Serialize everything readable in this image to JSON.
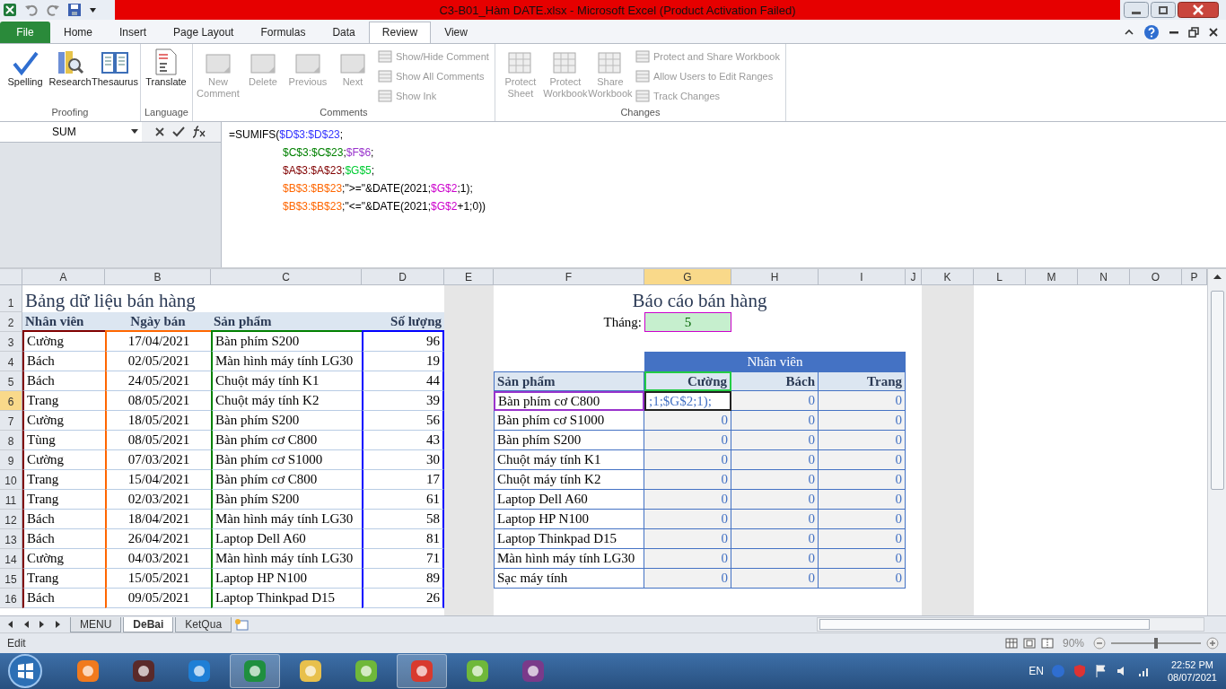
{
  "window": {
    "title": "C3-B01_Hàm DATE.xlsx  -  Microsoft Excel (Product Activation Failed)"
  },
  "ribbon_tabs": [
    {
      "label": "File",
      "kind": "file",
      "selected": false
    },
    {
      "label": "Home",
      "kind": "tab",
      "selected": false
    },
    {
      "label": "Insert",
      "kind": "tab",
      "selected": false
    },
    {
      "label": "Page Layout",
      "kind": "tab",
      "selected": false
    },
    {
      "label": "Formulas",
      "kind": "tab",
      "selected": false
    },
    {
      "label": "Data",
      "kind": "tab",
      "selected": false
    },
    {
      "label": "Review",
      "kind": "tab",
      "selected": true
    },
    {
      "label": "View",
      "kind": "tab",
      "selected": false
    }
  ],
  "ribbon_groups": [
    {
      "label": "Proofing",
      "buttons": [
        {
          "label": "Spelling",
          "kind": "large",
          "disabled": false
        },
        {
          "label": "Research",
          "kind": "large",
          "disabled": false
        },
        {
          "label": "Thesaurus",
          "kind": "large",
          "disabled": false
        }
      ]
    },
    {
      "label": "Language",
      "buttons": [
        {
          "label": "Translate",
          "kind": "large",
          "disabled": false
        }
      ]
    },
    {
      "label": "Comments",
      "buttons": [
        {
          "label": "New Comment",
          "kind": "large",
          "disabled": true
        },
        {
          "label": "Delete",
          "kind": "large",
          "disabled": true
        },
        {
          "label": "Previous",
          "kind": "large",
          "disabled": true
        },
        {
          "label": "Next",
          "kind": "large",
          "disabled": true
        },
        {
          "label": "Show/Hide Comment",
          "kind": "small",
          "disabled": true
        },
        {
          "label": "Show All Comments",
          "kind": "small",
          "disabled": true
        },
        {
          "label": "Show Ink",
          "kind": "small",
          "disabled": true
        }
      ]
    },
    {
      "label": "Changes",
      "buttons": [
        {
          "label": "Protect Sheet",
          "kind": "large",
          "disabled": true
        },
        {
          "label": "Protect Workbook",
          "kind": "large",
          "disabled": true
        },
        {
          "label": "Share Workbook",
          "kind": "large",
          "disabled": true
        },
        {
          "label": "Protect and Share Workbook",
          "kind": "small",
          "disabled": true
        },
        {
          "label": "Allow Users to Edit Ranges",
          "kind": "small",
          "disabled": true
        },
        {
          "label": "Track Changes",
          "kind": "small",
          "disabled": true
        }
      ]
    }
  ],
  "name_box": "SUM",
  "formula": [
    [
      {
        "text": "=SUMIFS("
      },
      {
        "text": "$D$3:$D$23",
        "color": "#3333ff"
      },
      {
        "text": ";"
      }
    ],
    [
      {
        "text": "$C$3:$C$23",
        "color": "#008000"
      },
      {
        "text": ";"
      },
      {
        "text": "$F$6",
        "color": "#9933cc"
      },
      {
        "text": ";"
      }
    ],
    [
      {
        "text": "$A$3:$A$23",
        "color": "#800000"
      },
      {
        "text": ";"
      },
      {
        "text": "$G$5",
        "color": "#00cc33"
      },
      {
        "text": ";"
      }
    ],
    [
      {
        "text": "$B$3:$B$23",
        "color": "#ff6600"
      },
      {
        "text": ";\">=\"&DATE(2021;"
      },
      {
        "text": "$G$2",
        "color": "#cc00cc"
      },
      {
        "text": ";1);"
      }
    ],
    [
      {
        "text": "$B$3:$B$23",
        "color": "#ff6600"
      },
      {
        "text": ";\"<=\"&DATE(2021;"
      },
      {
        "text": "$G$2",
        "color": "#cc00cc"
      },
      {
        "text": "+1;0))"
      }
    ]
  ],
  "columns": [
    {
      "label": "A",
      "selected": false
    },
    {
      "label": "B",
      "selected": false
    },
    {
      "label": "C",
      "selected": false
    },
    {
      "label": "D",
      "selected": false
    },
    {
      "label": "E",
      "selected": false
    },
    {
      "label": "F",
      "selected": false
    },
    {
      "label": "G",
      "selected": true
    },
    {
      "label": "H",
      "selected": false
    },
    {
      "label": "I",
      "selected": false
    },
    {
      "label": "J",
      "selected": false
    },
    {
      "label": "K",
      "selected": false
    },
    {
      "label": "L",
      "selected": false
    },
    {
      "label": "M",
      "selected": false
    },
    {
      "label": "N",
      "selected": false
    },
    {
      "label": "O",
      "selected": false
    },
    {
      "label": "P",
      "selected": false
    }
  ],
  "rows": [
    {
      "label": "1",
      "selected": false
    },
    {
      "label": "2",
      "selected": false
    },
    {
      "label": "3",
      "selected": false
    },
    {
      "label": "4",
      "selected": false
    },
    {
      "label": "5",
      "selected": false
    },
    {
      "label": "6",
      "selected": true
    },
    {
      "label": "7",
      "selected": false
    },
    {
      "label": "8",
      "selected": false
    },
    {
      "label": "9",
      "selected": false
    },
    {
      "label": "10",
      "selected": false
    },
    {
      "label": "11",
      "selected": false
    },
    {
      "label": "12",
      "selected": false
    },
    {
      "label": "13",
      "selected": false
    },
    {
      "label": "14",
      "selected": false
    },
    {
      "label": "15",
      "selected": false
    },
    {
      "label": "16",
      "selected": false
    }
  ],
  "data_table": {
    "title": "Bảng dữ liệu bán hàng",
    "columns": [
      {
        "label": "Nhân viên",
        "color": "#800000"
      },
      {
        "label": "Ngày bán",
        "color": "#ff6600"
      },
      {
        "label": "Sản phẩm",
        "color": "#008000"
      },
      {
        "label": "Số lượng",
        "color": "#0000ff"
      }
    ],
    "rows": [
      [
        "Cường",
        "17/04/2021",
        "Bàn phím S200",
        "96"
      ],
      [
        "Bách",
        "02/05/2021",
        "Màn hình máy tính LG30",
        "19"
      ],
      [
        "Bách",
        "24/05/2021",
        "Chuột máy tính K1",
        "44"
      ],
      [
        "Trang",
        "08/05/2021",
        "Chuột máy tính K2",
        "39"
      ],
      [
        "Cường",
        "18/05/2021",
        "Bàn phím S200",
        "56"
      ],
      [
        "Tùng",
        "08/05/2021",
        "Bàn phím cơ C800",
        "43"
      ],
      [
        "Cường",
        "07/03/2021",
        "Bàn phím cơ S1000",
        "30"
      ],
      [
        "Trang",
        "15/04/2021",
        "Bàn phím cơ C800",
        "17"
      ],
      [
        "Trang",
        "02/03/2021",
        "Bàn phím S200",
        "61"
      ],
      [
        "Bách",
        "18/04/2021",
        "Màn hình máy tính LG30",
        "58"
      ],
      [
        "Bách",
        "26/04/2021",
        "Laptop Dell A60",
        "81"
      ],
      [
        "Cường",
        "04/03/2021",
        "Màn hình máy tính LG30",
        "71"
      ],
      [
        "Trang",
        "15/05/2021",
        "Laptop HP N100",
        "89"
      ],
      [
        "Bách",
        "09/05/2021",
        "Laptop Thinkpad D15",
        "26"
      ]
    ]
  },
  "report": {
    "title": "Báo cáo bán hàng",
    "month_label": "Tháng:",
    "month_value": "5",
    "group_header": "Nhân viên",
    "columns": [
      "Sản phẩm",
      "Cường",
      "Bách",
      "Trang"
    ],
    "rows": [
      {
        "product": "Bàn phím cơ C800",
        "values": [
          {
            "text": ";1;$G$2;1);",
            "editing": true
          },
          {
            "text": "0",
            "editing": false
          },
          {
            "text": "0",
            "editing": false
          }
        ]
      },
      {
        "product": "Bàn phím cơ S1000",
        "values": [
          {
            "text": "0",
            "editing": false
          },
          {
            "text": "0",
            "editing": false
          },
          {
            "text": "0",
            "editing": false
          }
        ]
      },
      {
        "product": "Bàn phím S200",
        "values": [
          {
            "text": "0",
            "editing": false
          },
          {
            "text": "0",
            "editing": false
          },
          {
            "text": "0",
            "editing": false
          }
        ]
      },
      {
        "product": "Chuột máy tính K1",
        "values": [
          {
            "text": "0",
            "editing": false
          },
          {
            "text": "0",
            "editing": false
          },
          {
            "text": "0",
            "editing": false
          }
        ]
      },
      {
        "product": "Chuột máy tính K2",
        "values": [
          {
            "text": "0",
            "editing": false
          },
          {
            "text": "0",
            "editing": false
          },
          {
            "text": "0",
            "editing": false
          }
        ]
      },
      {
        "product": "Laptop Dell A60",
        "values": [
          {
            "text": "0",
            "editing": false
          },
          {
            "text": "0",
            "editing": false
          },
          {
            "text": "0",
            "editing": false
          }
        ]
      },
      {
        "product": "Laptop HP N100",
        "values": [
          {
            "text": "0",
            "editing": false
          },
          {
            "text": "0",
            "editing": false
          },
          {
            "text": "0",
            "editing": false
          }
        ]
      },
      {
        "product": "Laptop Thinkpad D15",
        "values": [
          {
            "text": "0",
            "editing": false
          },
          {
            "text": "0",
            "editing": false
          },
          {
            "text": "0",
            "editing": false
          }
        ]
      },
      {
        "product": "Màn hình máy tính LG30",
        "values": [
          {
            "text": "0",
            "editing": false
          },
          {
            "text": "0",
            "editing": false
          },
          {
            "text": "0",
            "editing": false
          }
        ]
      },
      {
        "product": "Sạc máy tính",
        "values": [
          {
            "text": "0",
            "editing": false
          },
          {
            "text": "0",
            "editing": false
          },
          {
            "text": "0",
            "editing": false
          }
        ]
      }
    ]
  },
  "sheet_tabs": [
    {
      "label": "MENU",
      "selected": false
    },
    {
      "label": "DeBai",
      "selected": true
    },
    {
      "label": "KetQua",
      "selected": false
    }
  ],
  "status_bar": {
    "mode": "Edit",
    "zoom": "90%",
    "zoom_slider": {
      "level": 0.5
    }
  },
  "taskbar": {
    "language": "EN",
    "time": "22:52 PM",
    "date": "08/07/2021"
  }
}
